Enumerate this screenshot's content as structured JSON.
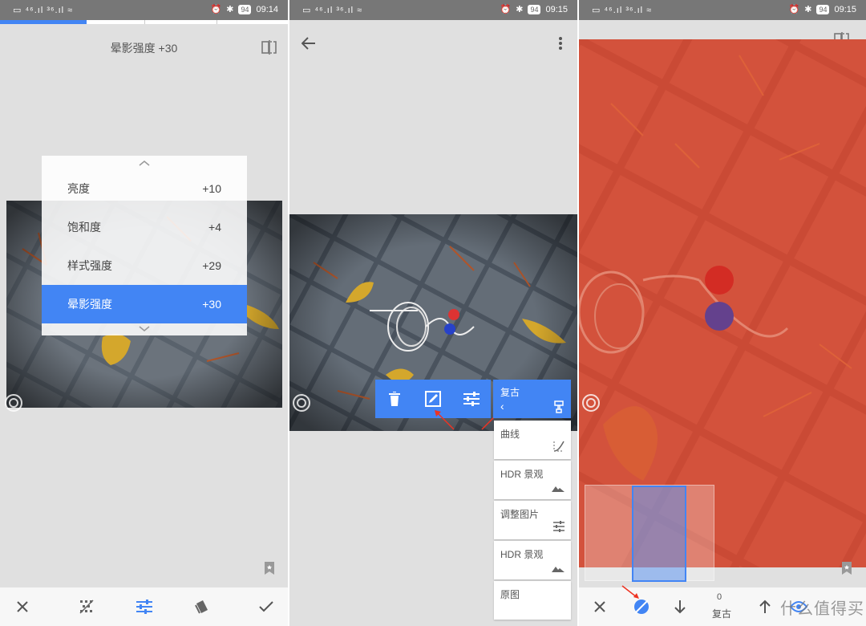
{
  "status": {
    "left": "▭ ⁴⁶.ıl ³⁶.ıl ≈",
    "battery": "94",
    "times": [
      "09:14",
      "09:15",
      "09:15"
    ]
  },
  "panel1": {
    "title": "晕影强度 +30",
    "menu": [
      {
        "label": "亮度",
        "value": "+10"
      },
      {
        "label": "饱和度",
        "value": "+4"
      },
      {
        "label": "样式强度",
        "value": "+29"
      },
      {
        "label": "晕影强度",
        "value": "+30"
      }
    ]
  },
  "panel2": {
    "stack": [
      {
        "label": "复古",
        "sub": "‹"
      },
      {
        "label": "曲线"
      },
      {
        "label": "HDR 景观"
      },
      {
        "label": "调整图片"
      },
      {
        "label": "HDR 景观"
      },
      {
        "label": "原图"
      }
    ]
  },
  "panel3": {
    "mask_value": "0",
    "mask_label": "复古",
    "watermark": "什么值得买"
  },
  "colors": {
    "accent": "#4285f4",
    "status": "#777777",
    "mask": "#d9442e"
  }
}
